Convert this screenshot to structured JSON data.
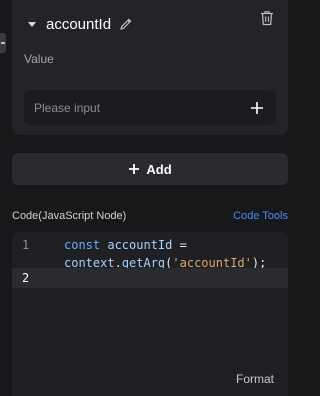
{
  "param": {
    "name": "accountId",
    "value_label": "Value",
    "placeholder": "Please input"
  },
  "add_button": {
    "label": "Add"
  },
  "code": {
    "title": "Code(JavaScript Node)",
    "tools_label": "Code Tools",
    "format_label": "Format",
    "lines": [
      {
        "number": "1",
        "tokens": [
          "const",
          "accountId",
          "=",
          "context",
          ".",
          "getArg",
          "(",
          "'accountId'",
          ");"
        ]
      },
      {
        "number": "2",
        "tokens": []
      }
    ]
  },
  "colors": {
    "background": "#17181a",
    "card": "#232427",
    "accent": "#4d8bf7",
    "keyword": "#6ea8ff",
    "string": "#e2a56a"
  }
}
